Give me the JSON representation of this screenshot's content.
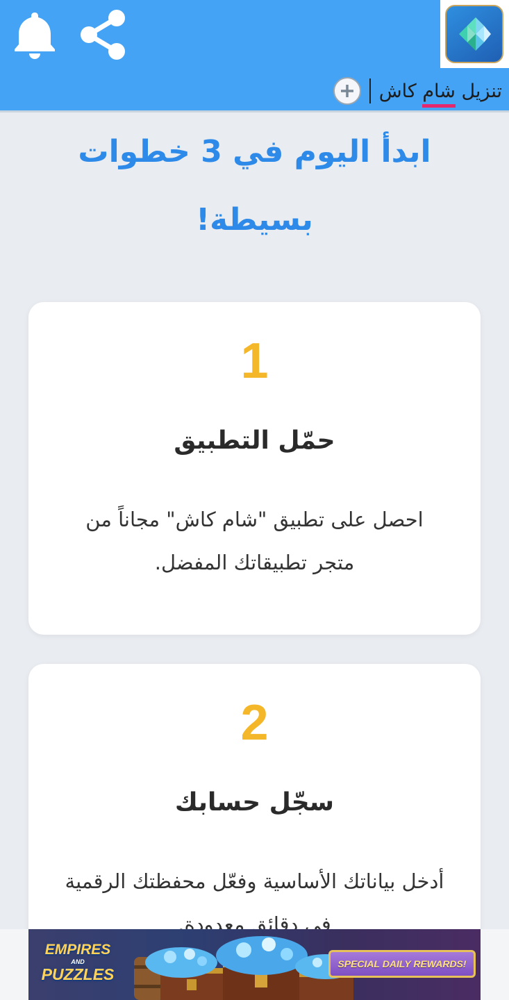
{
  "topbar": {
    "background_color": "#45a3f5",
    "notification_icon": "bell-icon",
    "share_icon": "share-icon",
    "app_icon": "app-logo-icon"
  },
  "search": {
    "query_before": "تنزيل ",
    "query_highlight": "شام",
    "query_after": " كاش",
    "highlight_color": "#e5286e",
    "add_icon": "plus-circle-icon"
  },
  "page": {
    "headline": "ابدأ اليوم في 3 خطوات بسيطة!",
    "headline_color": "#2e8ae8",
    "accent_color": "#f5b72a"
  },
  "steps": [
    {
      "number": "1",
      "title": "حمّل التطبيق",
      "description": "احصل على تطبيق \"شام كاش\" مجاناً من متجر تطبيقاتك المفضل."
    },
    {
      "number": "2",
      "title": "سجّل حسابك",
      "description": "أدخل بياناتك الأساسية وفعّل محفظتك الرقمية في دقائق معدودة."
    }
  ],
  "ad": {
    "logo_line1": "EMPIRES",
    "logo_line2": "AND",
    "logo_line3": "PUZZLES",
    "reward_label": "SPECIAL DAILY REWARDS!"
  }
}
